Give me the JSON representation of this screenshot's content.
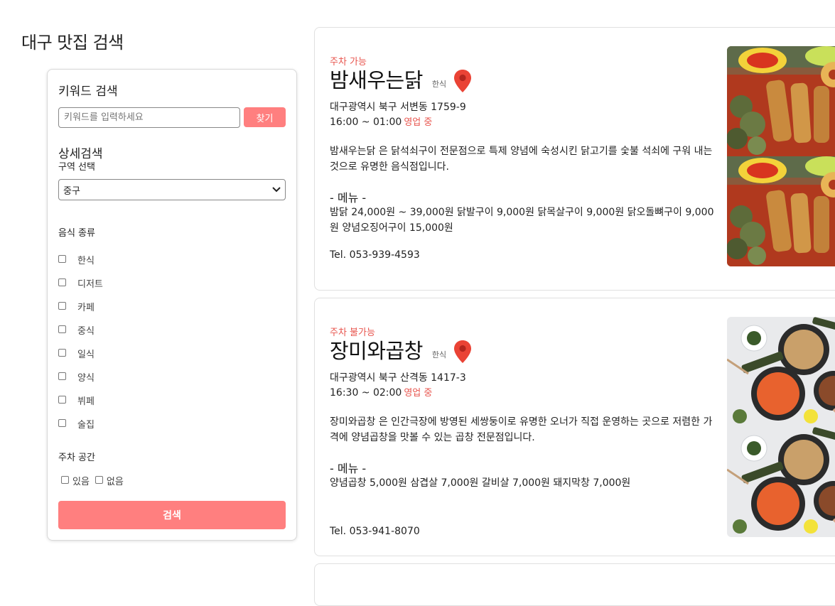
{
  "page": {
    "title": "대구 맛집 검색"
  },
  "sidebar": {
    "keyword_title": "키워드 검색",
    "search_placeholder": "키워드를 입력하세요",
    "find_label": "찾기",
    "detail_title": "상세검색",
    "region_label": "구역 선택",
    "region_selected": "중구",
    "food_label": "음식 종류",
    "food_types": [
      "한식",
      "디저트",
      "카페",
      "중식",
      "일식",
      "양식",
      "뷔페",
      "술집"
    ],
    "parking_label": "주차 공간",
    "parking_options": [
      "있음",
      "없음"
    ],
    "submit_label": "검색"
  },
  "restaurants": [
    {
      "parking": "주차 가능",
      "name": "밤새우는닭",
      "category": "한식",
      "address": "대구광역시 북구 서변동 1759-9",
      "hours": "16:00 ~ 01:00",
      "status": "영업 중",
      "description": "밤새우는닭 은 닭석쇠구이 전문점으로 특제 양념에 숙성시킨 닭고기를 숯불 석쇠에 구워 내는 것으로 유명한 음식점입니다.",
      "menu_title": "- 메뉴 -",
      "menu": "밤닭 24,000원 ~ 39,000원 닭발구이 9,000원 닭목살구이 9,000원 닭오돌뼈구이 9,000원 양념오징어구이 15,000원",
      "tel": "Tel. 053-939-4593"
    },
    {
      "parking": "주차 불가능",
      "name": "장미와곱창",
      "category": "한식",
      "address": "대구광역시 북구 산격동 1417-3",
      "hours": "16:30 ~ 02:00",
      "status": "영업 중",
      "description": "장미와곱창 은 인간극장에 방영된 세쌍둥이로 유명한 오너가 직접 운영하는 곳으로 저렴한 가격에 양념곱창을 맛볼 수 있는 곱창 전문점입니다.",
      "menu_title": "- 메뉴 -",
      "menu": "양념곱창 5,000원 삼겹살 7,000원 갈비살 7,000원 돼지막창 7,000원",
      "tel": "Tel. 053-941-8070"
    }
  ],
  "colors": {
    "accent": "#ff7f7f",
    "status_red": "#e8554e",
    "pin_red": "#ea4335"
  }
}
